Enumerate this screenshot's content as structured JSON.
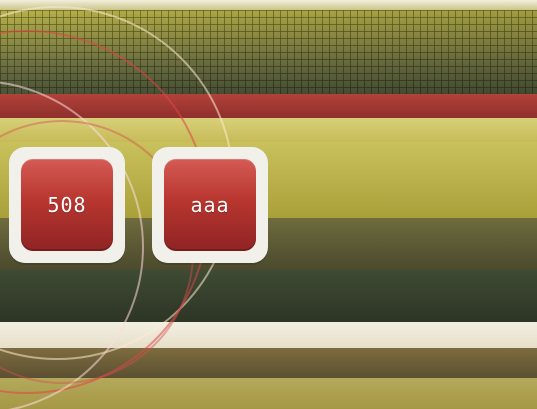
{
  "tiles": [
    {
      "label": "508"
    },
    {
      "label": "aaa"
    }
  ],
  "colors": {
    "tile_border": "#f2f0ea",
    "tile_red": "#b8362f",
    "band_red": "#8f2f2c",
    "band_yellow": "#c9c15b",
    "band_dark": "#2d3525"
  }
}
